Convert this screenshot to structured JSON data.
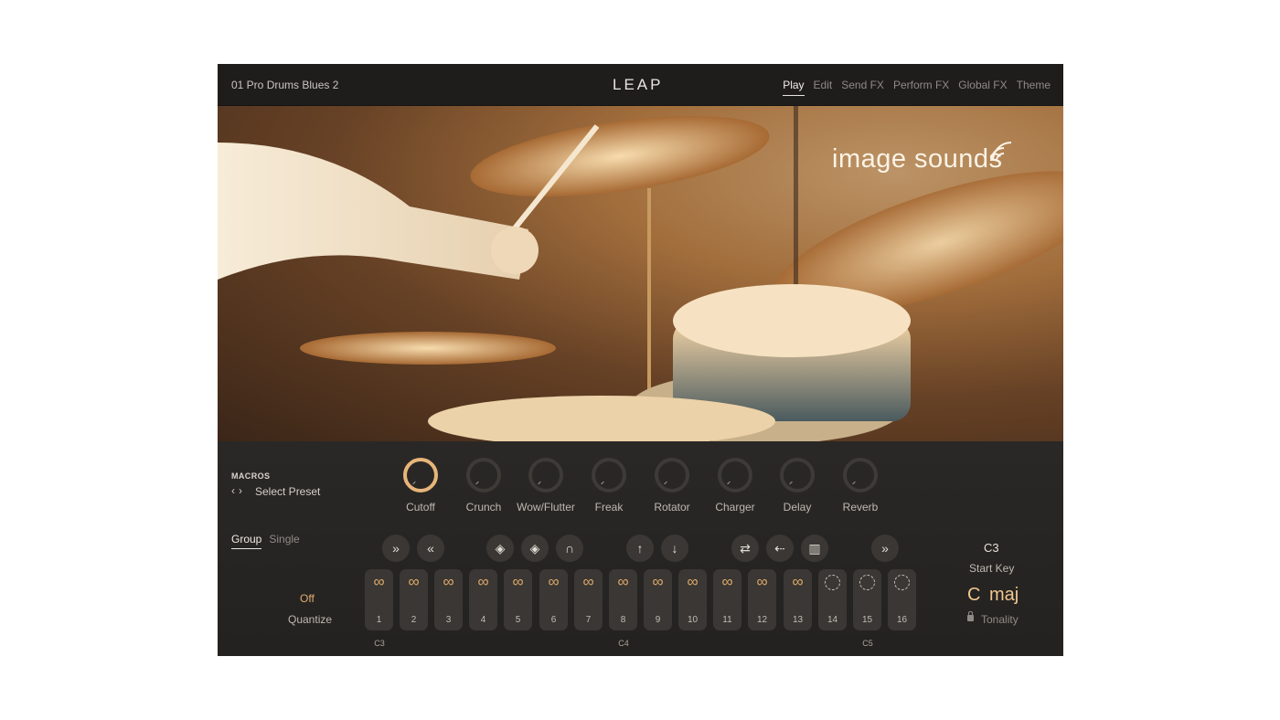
{
  "header": {
    "preset_name": "01 Pro Drums Blues 2",
    "logo": "LEAP",
    "tabs": [
      {
        "label": "Play",
        "active": true
      },
      {
        "label": "Edit"
      },
      {
        "label": "Send FX"
      },
      {
        "label": "Perform FX"
      },
      {
        "label": "Global FX"
      },
      {
        "label": "Theme"
      }
    ]
  },
  "artwork": {
    "brand": "image sounds",
    "icon": "wifi-waves-icon"
  },
  "macros": {
    "title": "MACROS",
    "select_preset": "Select Preset",
    "knobs": [
      {
        "label": "Cutoff",
        "active": true
      },
      {
        "label": "Crunch"
      },
      {
        "label": "Wow/Flutter"
      },
      {
        "label": "Freak"
      },
      {
        "label": "Rotator"
      },
      {
        "label": "Charger"
      },
      {
        "label": "Delay"
      },
      {
        "label": "Reverb"
      }
    ]
  },
  "modes": {
    "group": "Group",
    "single": "Single",
    "active": "Group"
  },
  "quantize": {
    "value": "Off",
    "label": "Quantize"
  },
  "action_buttons": [
    {
      "icon": "fast-forward-icon",
      "glyph": "»"
    },
    {
      "icon": "rewind-icon",
      "glyph": "«"
    },
    {
      "icon": "grid-diamond-icon",
      "glyph": "◈"
    },
    {
      "icon": "grid-diamond-2-icon",
      "glyph": "◈"
    },
    {
      "icon": "envelope-icon",
      "glyph": "∩"
    },
    {
      "icon": "arrow-up-icon",
      "glyph": "↑"
    },
    {
      "icon": "arrow-down-icon",
      "glyph": "↓"
    },
    {
      "icon": "swap-icon",
      "glyph": "⇄"
    },
    {
      "icon": "scatter-icon",
      "glyph": "⇠"
    },
    {
      "icon": "bars-icon",
      "glyph": "▥"
    },
    {
      "icon": "fast-forward-icon",
      "glyph": "»"
    }
  ],
  "pads": {
    "loop_symbol": "∞",
    "items": [
      {
        "num": "1",
        "state": "loop"
      },
      {
        "num": "2",
        "state": "loop"
      },
      {
        "num": "3",
        "state": "loop"
      },
      {
        "num": "4",
        "state": "loop"
      },
      {
        "num": "5",
        "state": "loop"
      },
      {
        "num": "6",
        "state": "loop"
      },
      {
        "num": "7",
        "state": "loop"
      },
      {
        "num": "8",
        "state": "loop"
      },
      {
        "num": "9",
        "state": "loop"
      },
      {
        "num": "10",
        "state": "loop"
      },
      {
        "num": "11",
        "state": "loop"
      },
      {
        "num": "12",
        "state": "loop"
      },
      {
        "num": "13",
        "state": "loop"
      },
      {
        "num": "14",
        "state": "empty"
      },
      {
        "num": "15",
        "state": "empty"
      },
      {
        "num": "16",
        "state": "empty"
      }
    ]
  },
  "note_labels": [
    "C3",
    "C4",
    "C5"
  ],
  "start_key": {
    "value": "C3",
    "label": "Start Key"
  },
  "tonality": {
    "key": "C",
    "scale": "maj",
    "label": "Tonality"
  },
  "colors": {
    "accent": "#e7b57a",
    "panel": "#262422",
    "pad": "#3a3734"
  }
}
